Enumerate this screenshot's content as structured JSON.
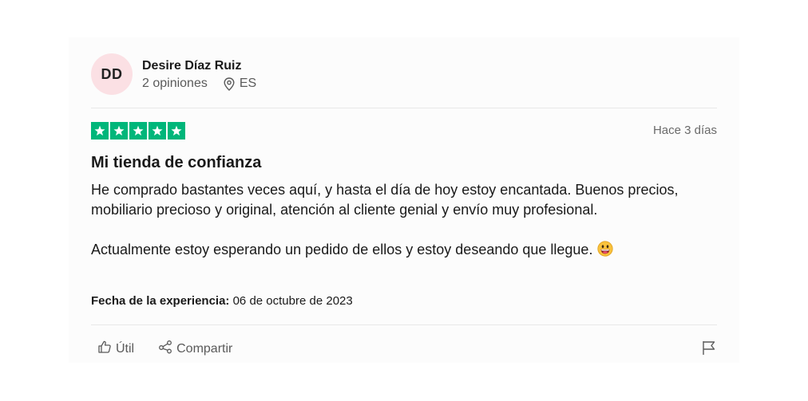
{
  "reviewer": {
    "initials": "DD",
    "name": "Desire Díaz Ruiz",
    "reviews_count": "2 opiniones",
    "country": "ES",
    "avatar_color": "#fbe0e4"
  },
  "review": {
    "rating": 5,
    "star_color": "#00b67a",
    "date": "Hace 3 días",
    "title": "Mi tienda de confianza",
    "paragraph_1": "He comprado bastantes veces aquí, y hasta el día de hoy estoy encantada. Buenos precios, mobiliario precioso y original, atención al cliente genial y envío muy profesional.",
    "paragraph_2": "Actualmente estoy esperando un pedido de ellos y estoy deseando que llegue.",
    "emoji": "grinning-face-emoji",
    "experience_label": "Fecha de la experiencia:",
    "experience_date": "06 de octubre de 2023"
  },
  "actions": {
    "useful_label": "Útil",
    "share_label": "Compartir",
    "report_icon": "flag-icon"
  }
}
